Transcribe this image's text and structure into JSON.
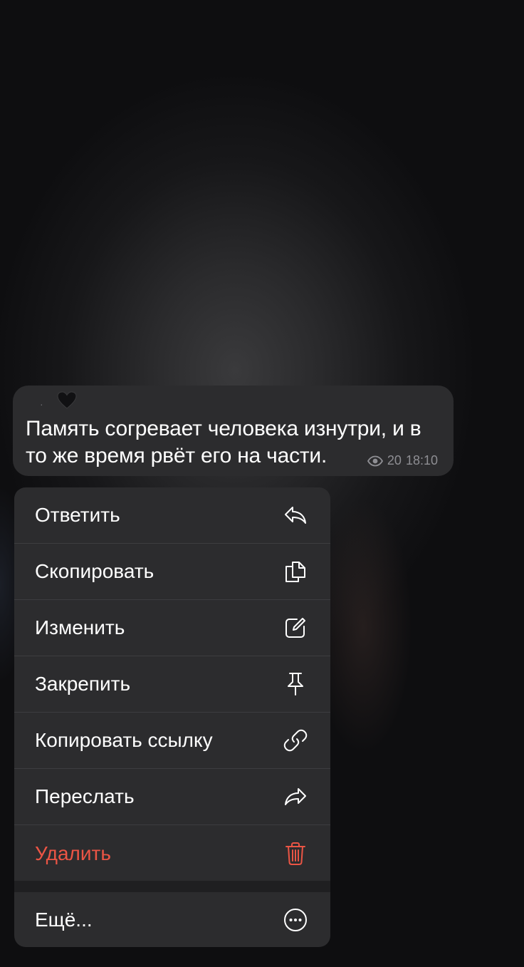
{
  "message": {
    "text": "Память согревает человека изнутри, и в то же время рвёт его на части.",
    "reaction_icon": "black-heart-icon",
    "views": "20",
    "time": "18:10"
  },
  "menu": {
    "items": [
      {
        "label": "Ответить",
        "icon": "reply-icon"
      },
      {
        "label": "Скопировать",
        "icon": "copy-icon"
      },
      {
        "label": "Изменить",
        "icon": "edit-icon"
      },
      {
        "label": "Закрепить",
        "icon": "pin-icon"
      },
      {
        "label": "Копировать ссылку",
        "icon": "link-icon"
      },
      {
        "label": "Переслать",
        "icon": "forward-icon"
      },
      {
        "label": "Удалить",
        "icon": "trash-icon"
      }
    ],
    "more": {
      "label": "Ещё...",
      "icon": "more-icon"
    }
  },
  "colors": {
    "danger": "#eb5545",
    "menu_bg": "#2c2c2e",
    "bubble_bg": "#2c2c2e",
    "text": "#ffffff",
    "meta": "#8e8e93"
  }
}
